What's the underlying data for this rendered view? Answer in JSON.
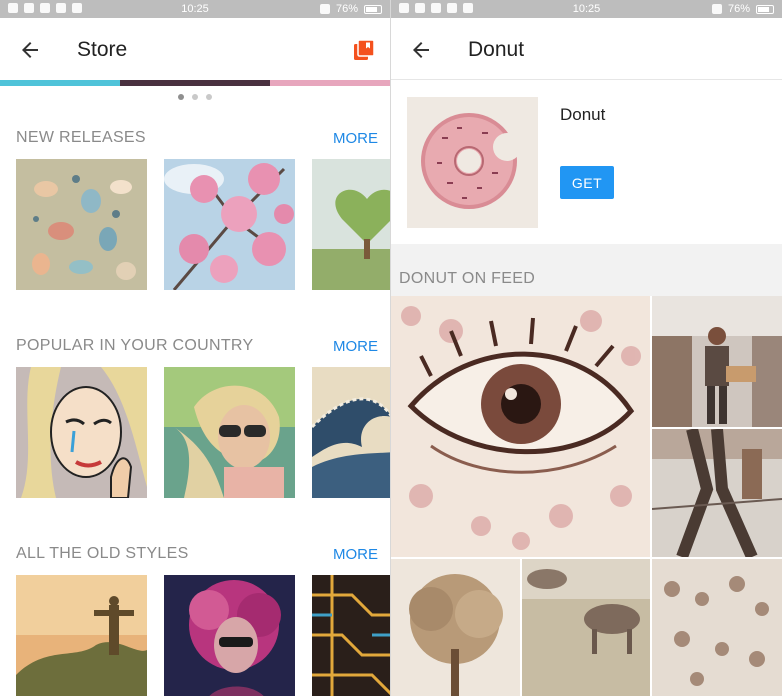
{
  "status_bar": {
    "time": "10:25",
    "battery": "76%",
    "left_icons": [
      "sim-icon",
      "camera-icon",
      "wifi-icon",
      "download-icon",
      "facebook-icon"
    ],
    "right_icons": [
      "nfc-icon",
      "bluetooth-icon",
      "alarm-icon",
      "battery-icon"
    ]
  },
  "store_screen": {
    "title": "Store",
    "icons": {
      "back": "back-arrow-icon",
      "action": "store-cards-icon"
    },
    "action_color": "#f4511e",
    "carousel": {
      "pages": 3,
      "active_page": 1
    },
    "sections": [
      {
        "title": "NEW RELEASES",
        "more_label": "MORE",
        "thumbnails": [
          "seashells",
          "cherry-blossom",
          "heart-tree"
        ]
      },
      {
        "title": "POPULAR IN YOUR COUNTRY",
        "more_label": "MORE",
        "thumbnails": [
          "pop-art-woman",
          "sunglasses-woman",
          "great-wave"
        ]
      },
      {
        "title": "ALL THE OLD STYLES",
        "more_label": "MORE",
        "thumbnails": [
          "christ-statue",
          "curly-hair-woman",
          "circuit-lines"
        ]
      }
    ]
  },
  "detail_screen": {
    "title": "Donut",
    "icons": {
      "back": "back-arrow-icon"
    },
    "style_name": "Donut",
    "get_label": "GET",
    "accent_color": "#2196f3",
    "feed_title": "DONUT ON FEED",
    "feed_images": [
      "eye",
      "standing-man",
      "walking-legs",
      "tree",
      "cows",
      "crowd"
    ]
  },
  "colors": {
    "link": "#1e88e5",
    "section_title": "#8a8a8a",
    "status_bar": "#bdbdbd"
  }
}
